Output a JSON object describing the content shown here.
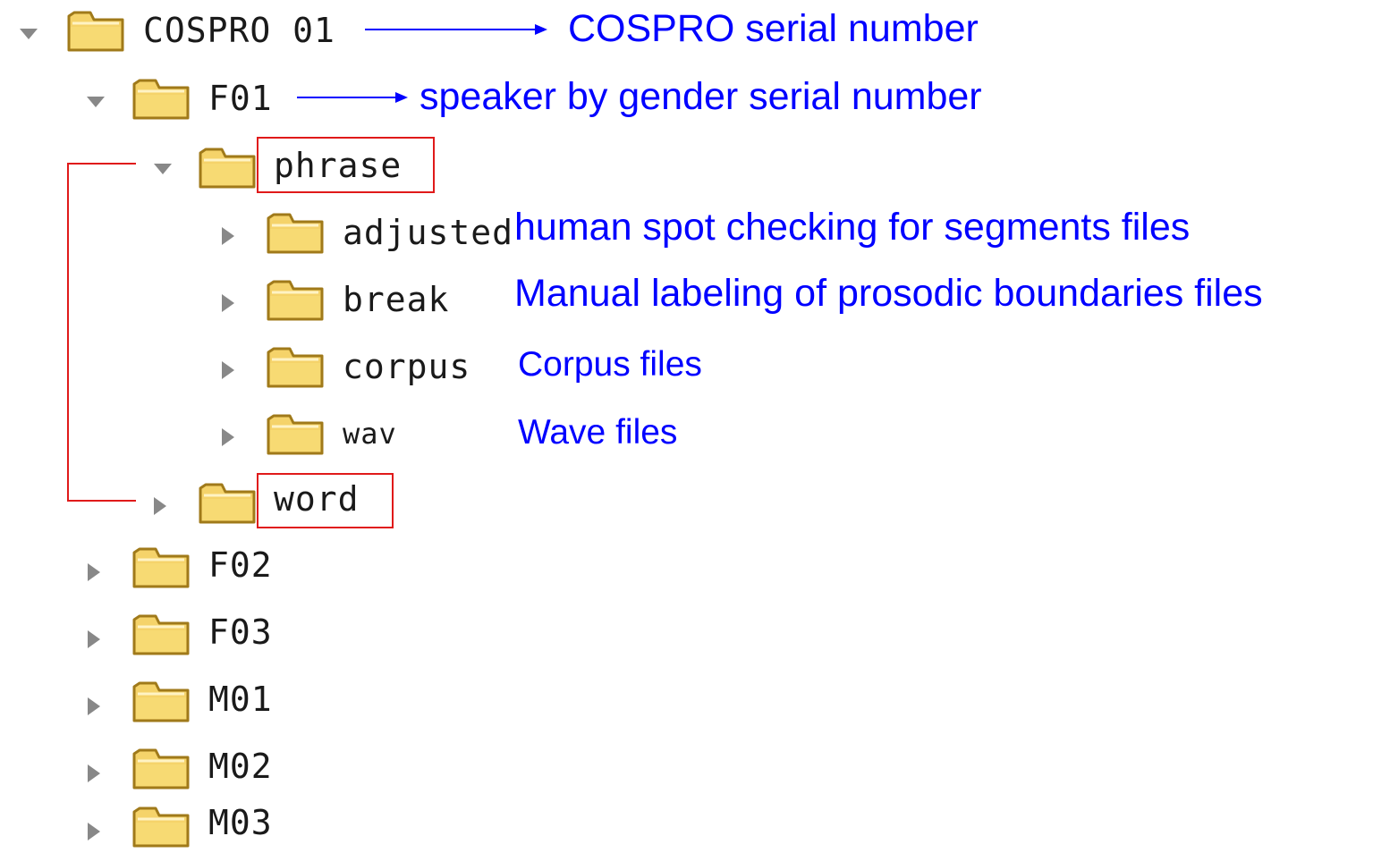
{
  "tree": {
    "root": {
      "label": "COSPRO 01",
      "expanded": true
    },
    "speaker_f01": {
      "label": "F01",
      "expanded": true
    },
    "phrase": {
      "label": "phrase",
      "expanded": true
    },
    "adjusted": {
      "label": "adjusted",
      "expanded": false
    },
    "break": {
      "label": "break",
      "expanded": false
    },
    "corpus": {
      "label": "corpus",
      "expanded": false
    },
    "wav": {
      "label": "wav",
      "expanded": false
    },
    "word": {
      "label": "word",
      "expanded": false
    },
    "speaker_f02": {
      "label": "F02",
      "expanded": false
    },
    "speaker_f03": {
      "label": "F03",
      "expanded": false
    },
    "speaker_m01": {
      "label": "M01",
      "expanded": false
    },
    "speaker_m02": {
      "label": "M02",
      "expanded": false
    },
    "speaker_m03": {
      "label": "M03",
      "expanded": false
    }
  },
  "annotations": {
    "root": "COSPRO serial number",
    "speaker": "speaker by gender serial number",
    "adjusted": "human spot checking for segments files",
    "break": "Manual  labeling of prosodic boundaries files",
    "corpus": "Corpus files",
    "wav": "Wave files"
  },
  "colors": {
    "annotation_text": "#0000ff",
    "highlight_box": "#e01a1a",
    "folder_fill": "#f5d36a",
    "folder_outline": "#a07a1a",
    "triangle": "#888888"
  },
  "icons": {
    "expanded": "triangle-down-icon",
    "collapsed": "triangle-right-icon",
    "folder": "folder-icon"
  }
}
